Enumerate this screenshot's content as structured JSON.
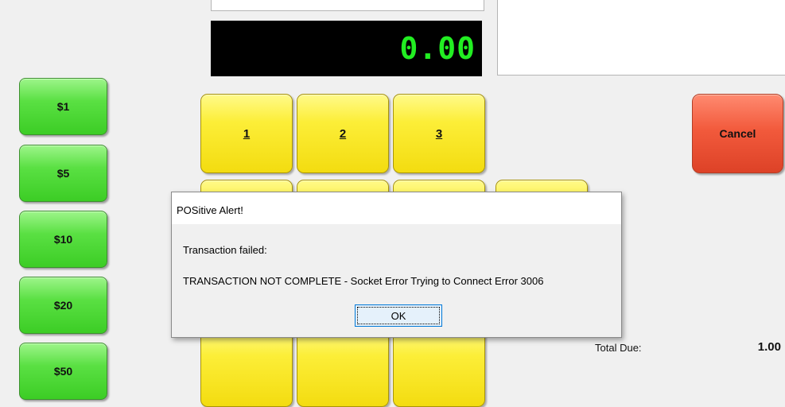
{
  "display": {
    "amount": "0.00"
  },
  "tender_buttons": [
    "$1",
    "$5",
    "$10",
    "$20",
    "$50"
  ],
  "keypad": {
    "key1": "1",
    "key2": "2",
    "key3": "3"
  },
  "cancel_label": "Cancel",
  "totals": {
    "label": "Total Due:",
    "value": "1.00"
  },
  "alert": {
    "title": "POSitive Alert!",
    "message_line1": "Transaction failed:",
    "message_line2": "TRANSACTION NOT COMPLETE - Socket Error Trying to Connect Error 3006",
    "ok_label": "OK"
  },
  "colors": {
    "display_text": "#22ee22",
    "tender_green": "#5ae043",
    "keypad_yellow": "#fcee38",
    "cancel_red": "#f25a3c"
  }
}
